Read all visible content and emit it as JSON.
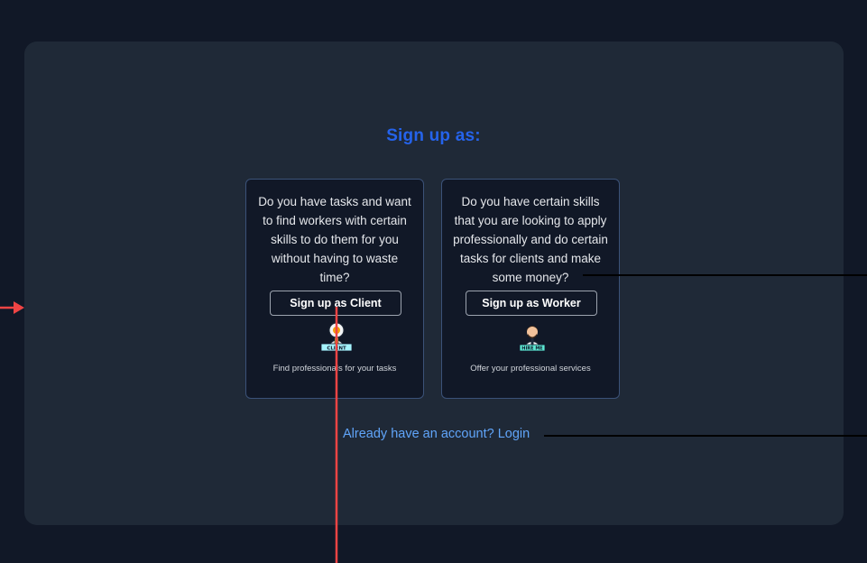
{
  "heading": "Sign up as:",
  "cards": [
    {
      "description": "Do you have tasks and want to find workers with certain skills to do them for you without having to waste time?",
      "button": "Sign up as Client",
      "badge": "CLIENT",
      "caption": "Find professionals for your tasks"
    },
    {
      "description": "Do you have certain skills that you are looking to apply professionally and do certain tasks for clients and make some money?",
      "button": "Sign up as Worker",
      "badge": "HIRE ME",
      "caption": "Offer your professional services"
    }
  ],
  "login_link": "Already have an account? Login",
  "colors": {
    "page_background": "#111827",
    "panel_background": "#1f2937",
    "heading": "#2563eb",
    "link": "#60a5fa",
    "annotation_red": "#ef4444",
    "annotation_black": "#000000"
  }
}
